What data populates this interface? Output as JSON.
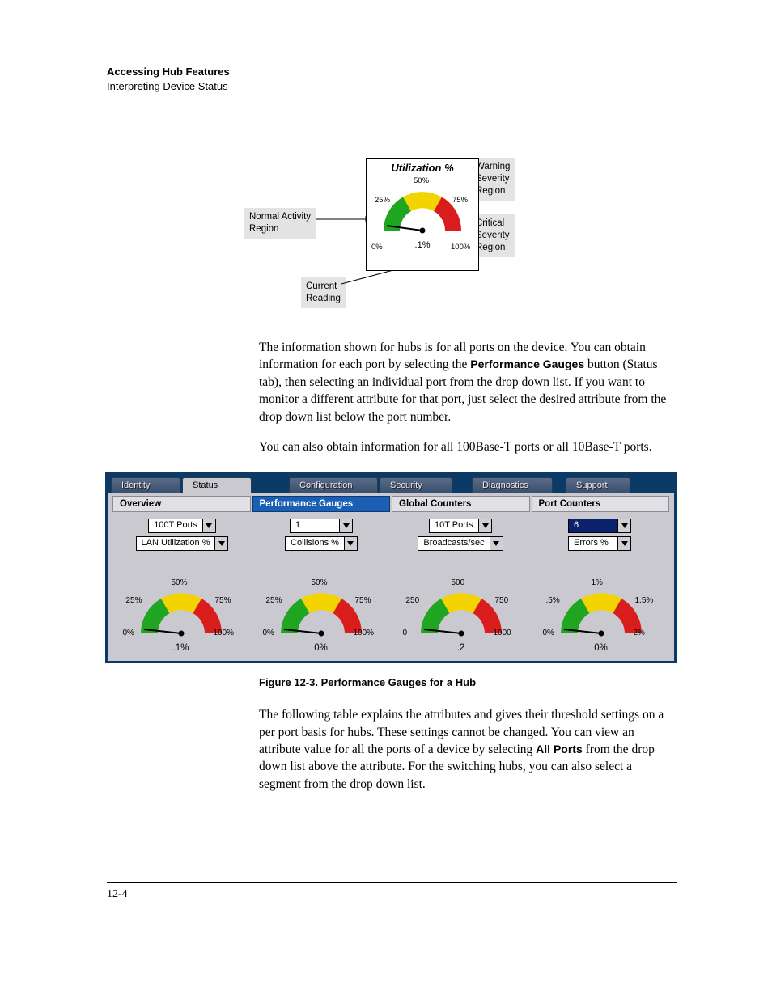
{
  "header": {
    "title": "Accessing Hub Features",
    "subtitle": "Interpreting Device Status"
  },
  "annotated_gauge": {
    "title": "Utilization %",
    "ticks": {
      "t0": "0%",
      "t25": "25%",
      "t50": "50%",
      "t75": "75%",
      "t100": "100%"
    },
    "reading": ".1%",
    "callouts": {
      "normal": "Normal Activity\nRegion",
      "warning": "Warning\nSeverity\nRegion",
      "critical": "Critical\nSeverity\nRegion",
      "current": "Current\nReading"
    }
  },
  "para1_a": "The information shown for hubs is for all ports on the device. You can obtain information for each port by selecting the ",
  "para1_bold": "Performance Gauges",
  "para1_b": " button (Status tab), then selecting an individual port from the drop down list. If you want to monitor a different attribute for that port, just select the desired attribute from the drop down list below the port number.",
  "para2": "You can also obtain information for all 100Base-T ports or all 10Base-T ports.",
  "screenshot": {
    "tabs": {
      "identity": "Identity",
      "status": "Status",
      "configuration": "Configuration",
      "security": "Security",
      "diagnostics": "Diagnostics",
      "support": "Support"
    },
    "subtabs": {
      "overview": "Overview",
      "perf": "Performance Gauges",
      "global": "Global Counters",
      "port": "Port Counters"
    },
    "columns": [
      {
        "top": "100T Ports",
        "bottom": "LAN Utilization %",
        "highlight": false,
        "gauge": {
          "ticks": [
            "0%",
            "25%",
            "50%",
            "75%",
            "100%"
          ],
          "reading": ".1%"
        }
      },
      {
        "top": "1",
        "bottom": "Collisions %",
        "highlight": false,
        "gauge": {
          "ticks": [
            "0%",
            "25%",
            "50%",
            "75%",
            "100%"
          ],
          "reading": "0%"
        }
      },
      {
        "top": "10T Ports",
        "bottom": "Broadcasts/sec",
        "highlight": false,
        "gauge": {
          "ticks": [
            "0",
            "250",
            "500",
            "750",
            "1000"
          ],
          "reading": ".2"
        }
      },
      {
        "top": "6",
        "bottom": "Errors %",
        "highlight": true,
        "gauge": {
          "ticks": [
            "0%",
            ".5%",
            "1%",
            "1.5%",
            "2%"
          ],
          "reading": "0%"
        }
      }
    ]
  },
  "figcaption": "Figure 12-3.  Performance Gauges for a Hub",
  "para3_a": "The following table explains the attributes and gives their threshold settings on a per port basis for hubs. These settings cannot be changed. You can view an attribute value for all the ports of a device by selecting ",
  "para3_bold": "All Ports",
  "para3_b": " from the drop down list above the attribute. For the switching hubs, you can also select a segment from the drop down list.",
  "pagenum": "12-4",
  "chart_data": [
    {
      "type": "gauge",
      "title": "Utilization %",
      "range": [
        0,
        100
      ],
      "ticks": [
        0,
        25,
        50,
        75,
        100
      ],
      "value": 0.1,
      "unit": "%",
      "zones": [
        {
          "name": "Normal Activity Region",
          "range": [
            0,
            40
          ],
          "color": "#1fa51f"
        },
        {
          "name": "Warning Severity Region",
          "range": [
            40,
            60
          ],
          "color": "#f3d400"
        },
        {
          "name": "Critical Severity Region",
          "range": [
            60,
            100
          ],
          "color": "#d91c1c"
        }
      ]
    },
    {
      "type": "gauge",
      "title": "LAN Utilization % (100T Ports)",
      "range": [
        0,
        100
      ],
      "ticks": [
        0,
        25,
        50,
        75,
        100
      ],
      "value": 0.1,
      "unit": "%"
    },
    {
      "type": "gauge",
      "title": "Collisions % (Port 1)",
      "range": [
        0,
        100
      ],
      "ticks": [
        0,
        25,
        50,
        75,
        100
      ],
      "value": 0,
      "unit": "%"
    },
    {
      "type": "gauge",
      "title": "Broadcasts/sec (10T Ports)",
      "range": [
        0,
        1000
      ],
      "ticks": [
        0,
        250,
        500,
        750,
        1000
      ],
      "value": 0.2,
      "unit": ""
    },
    {
      "type": "gauge",
      "title": "Errors % (Port 6)",
      "range": [
        0,
        2
      ],
      "ticks": [
        0,
        0.5,
        1,
        1.5,
        2
      ],
      "value": 0,
      "unit": "%"
    }
  ]
}
